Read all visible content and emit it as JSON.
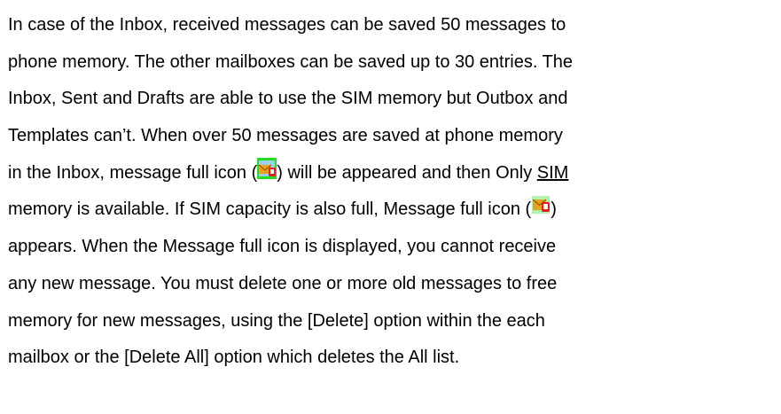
{
  "paragraph": {
    "line1": "In case of the Inbox, received messages can be saved 50 messages to",
    "line2": "phone memory. The other mailboxes can be saved up to 30 entries. The",
    "line3": "Inbox, Sent and Drafts are able to use the SIM memory but Outbox and",
    "line4": "Templates can’t. When over 50 messages are saved at phone memory",
    "line5_before_icon": "in the Inbox, message full icon (",
    "line5_after_icon": ") will be appeared and then Only ",
    "line5_sim": "SIM",
    "line6_before_icon": "memory is available. If SIM capacity is also full, Message full icon (",
    "line6_after_icon": ")",
    "line7": "appears. When the Message full icon is displayed, you cannot receive",
    "line8": "any new message. You must delete one or more old messages to free",
    "line9": "memory for new messages, using the [Delete] option within the each",
    "line10": "mailbox or the [Delete All] option which deletes the All list."
  },
  "icons": {
    "phone_memory_full_icon": "message-full-phone-memory-icon",
    "sim_memory_full_icon": "message-full-sim-memory-icon"
  },
  "colors": {
    "text": "#000000",
    "icon_green_border": "#22dd22",
    "icon_envelope": "#e8a020",
    "icon_red_badge": "#e02020"
  }
}
